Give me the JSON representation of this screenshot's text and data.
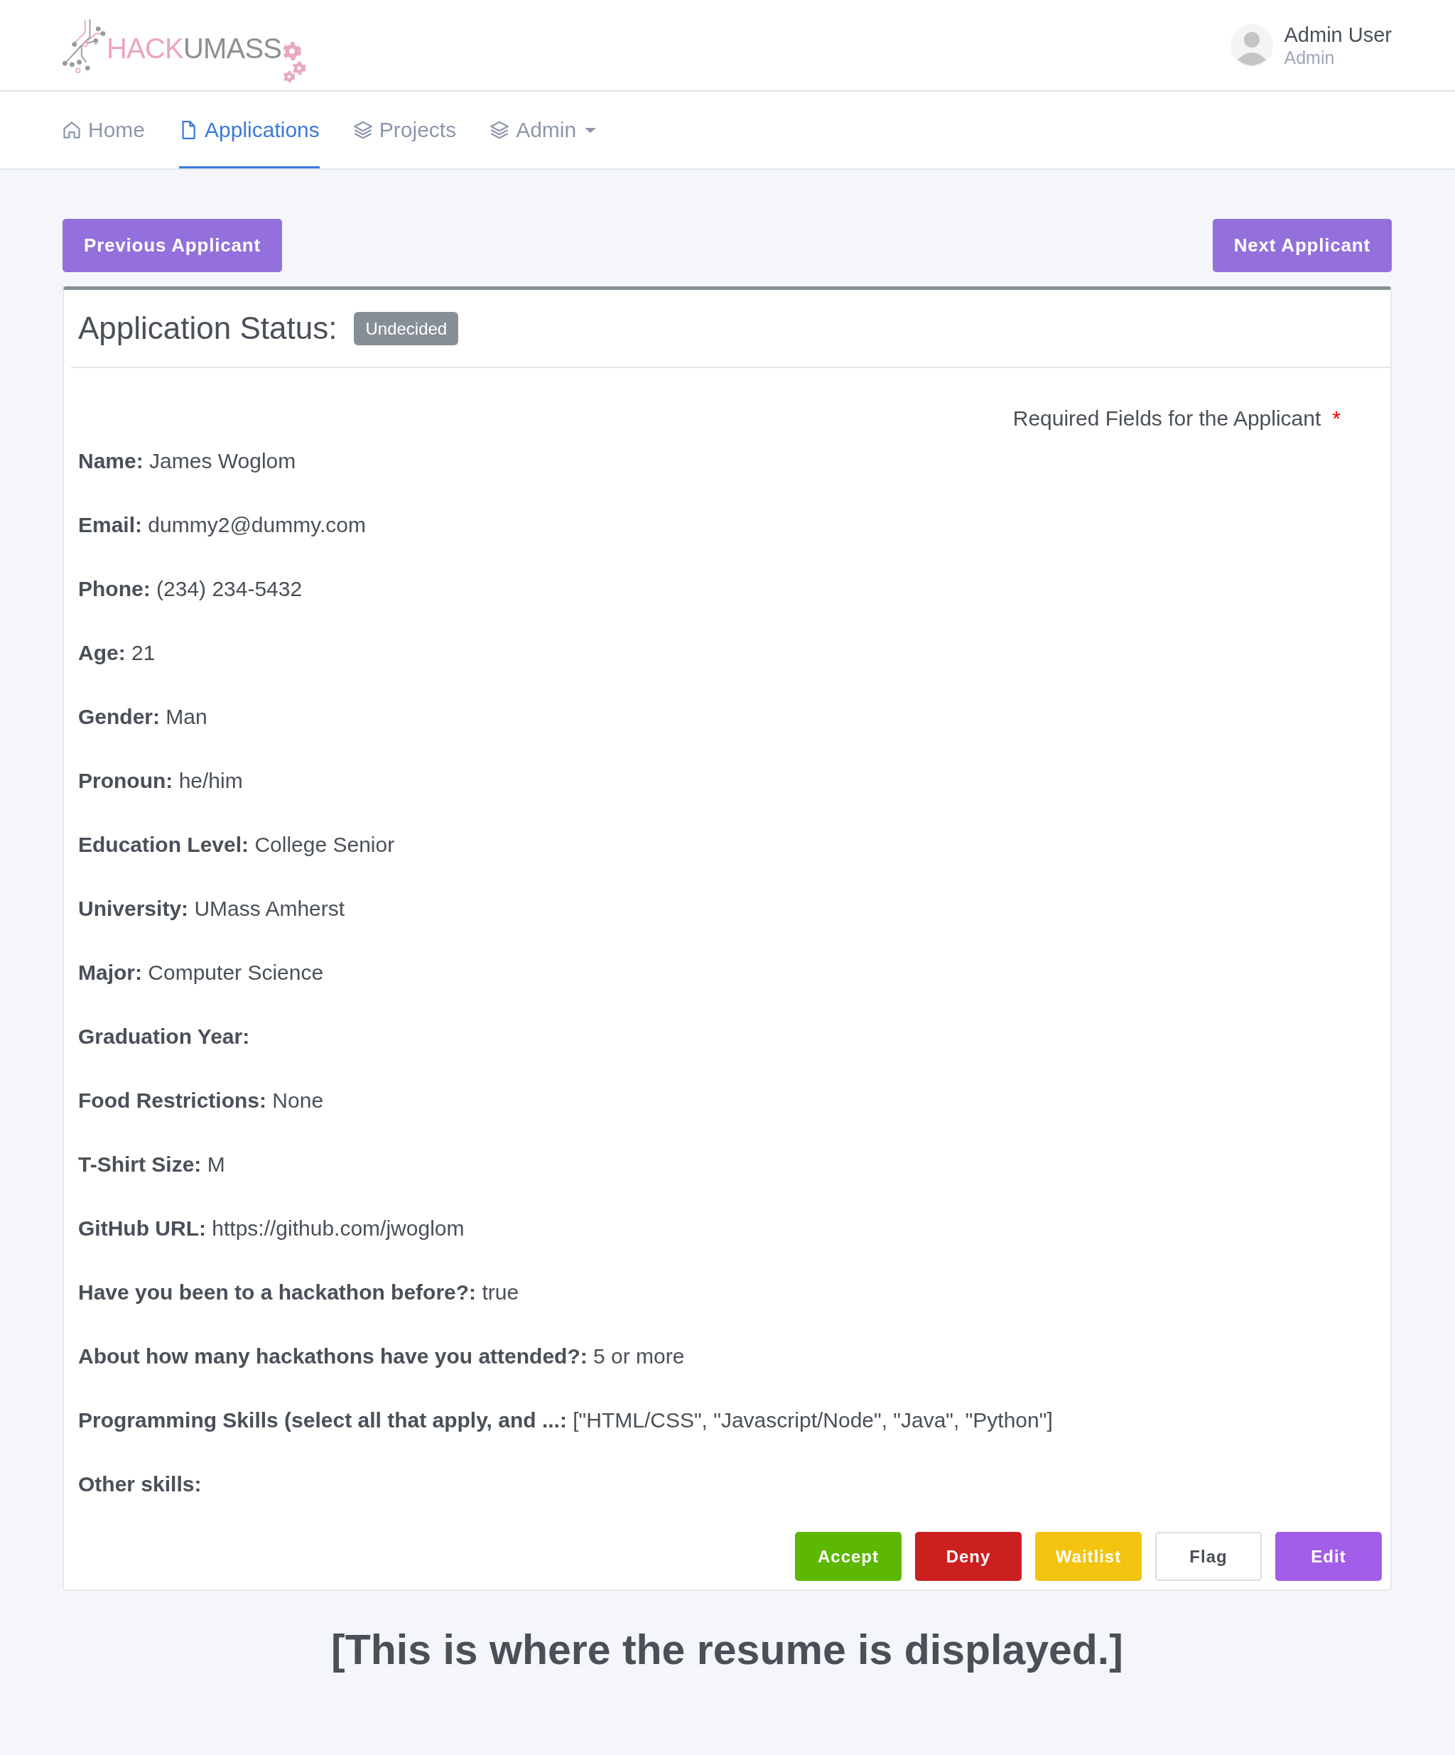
{
  "header": {
    "logo": {
      "first_word": "HACK",
      "second_word": "UMASS"
    },
    "user": {
      "name": "Admin User",
      "role": "Admin"
    }
  },
  "nav": {
    "tabs": [
      {
        "label": "Home",
        "selected": false,
        "dropdown": false
      },
      {
        "label": "Applications",
        "selected": true,
        "dropdown": false
      },
      {
        "label": "Projects",
        "selected": false,
        "dropdown": false
      },
      {
        "label": "Admin",
        "selected": false,
        "dropdown": true
      }
    ]
  },
  "pager": {
    "previous": "Previous Applicant",
    "next": "Next Applicant"
  },
  "application": {
    "status_label": "Application Status:",
    "status": "Undecided",
    "required_note": "Required Fields for the Applicant",
    "required_marker": "*",
    "fields": [
      {
        "label": "Name:",
        "value": "James Woglom"
      },
      {
        "label": "Email:",
        "value": "dummy2@dummy.com"
      },
      {
        "label": "Phone:",
        "value": "(234) 234-5432"
      },
      {
        "label": "Age:",
        "value": "21"
      },
      {
        "label": "Gender:",
        "value": "Man"
      },
      {
        "label": "Pronoun:",
        "value": "he/him"
      },
      {
        "label": "Education Level:",
        "value": "College Senior"
      },
      {
        "label": "University:",
        "value": "UMass Amherst"
      },
      {
        "label": "Major:",
        "value": "Computer Science"
      },
      {
        "label": "Graduation Year:"
      },
      {
        "label": "Food Restrictions:",
        "value": "None"
      },
      {
        "label": "T-Shirt Size:",
        "value": "M"
      },
      {
        "label": "GitHub URL:",
        "value": "https://github.com/jwoglom"
      },
      {
        "label": "Have you been to a hackathon before?:",
        "value": "true"
      },
      {
        "label": "About how many hackathons have you attended?:",
        "value": "5 or more"
      },
      {
        "label": "Programming Skills (select all that apply, and ...:",
        "value": "[\"HTML/CSS\", \"Javascript/Node\", \"Java\", \"Python\"]"
      },
      {
        "label": "Other skills:"
      }
    ],
    "actions": [
      {
        "label": "Accept",
        "kind": "success"
      },
      {
        "label": "Deny",
        "kind": "danger"
      },
      {
        "label": "Waitlist",
        "kind": "warning"
      },
      {
        "label": "Flag",
        "kind": "outline"
      },
      {
        "label": "Edit",
        "kind": "accent"
      }
    ]
  },
  "resume_placeholder": "[This is where the resume is displayed.]"
}
